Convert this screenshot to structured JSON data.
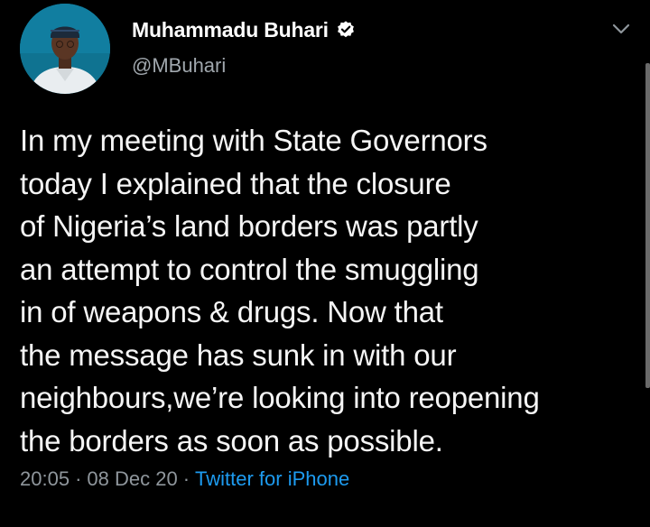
{
  "author": {
    "display_name": "Muhammadu Buhari",
    "handle": "@MBuhari",
    "verified": true,
    "avatar_icon": "profile-photo"
  },
  "tweet": {
    "lines": [
      "In my meeting with State Governors",
      "today I explained that the closure",
      "of Nigeria’s land borders was partly",
      "an attempt to control the smuggling",
      "in of weapons & drugs. Now that",
      "the message has sunk in with our",
      "neighbours,we’re looking into reopening",
      "the borders as soon as possible."
    ]
  },
  "meta": {
    "time": "20:05",
    "separator": "·",
    "date": "08 Dec 20",
    "source": "Twitter for iPhone"
  },
  "colors": {
    "background": "#000000",
    "text": "#ffffff",
    "secondary": "#8f969c",
    "link": "#1d9bf0"
  },
  "icons": {
    "verified": "verified-badge-icon",
    "menu": "chevron-down-icon"
  }
}
